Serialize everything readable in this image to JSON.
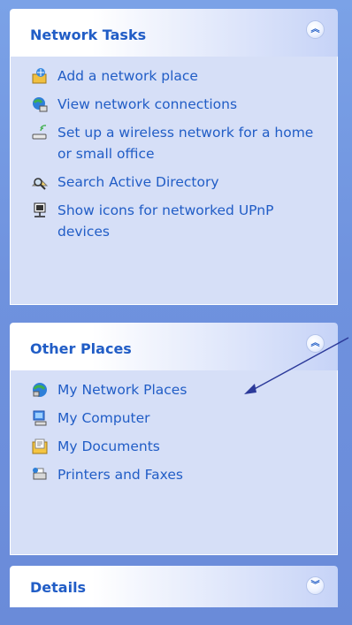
{
  "network_tasks": {
    "title": "Network Tasks",
    "items": [
      {
        "icon": "add-network-place-icon",
        "label": "Add a network place"
      },
      {
        "icon": "view-network-connections-icon",
        "label": "View network connections"
      },
      {
        "icon": "wireless-network-icon",
        "label": "Set up a wireless network for a home or small office"
      },
      {
        "icon": "search-directory-icon",
        "label": "Search Active Directory"
      },
      {
        "icon": "upnp-devices-icon",
        "label": "Show icons for networked UPnP devices"
      }
    ]
  },
  "other_places": {
    "title": "Other Places",
    "items": [
      {
        "icon": "my-network-places-icon",
        "label": "My Network Places"
      },
      {
        "icon": "my-computer-icon",
        "label": "My Computer"
      },
      {
        "icon": "my-documents-icon",
        "label": "My Documents"
      },
      {
        "icon": "printers-faxes-icon",
        "label": "Printers and Faxes"
      }
    ]
  },
  "details": {
    "title": "Details"
  },
  "colors": {
    "link": "#215dc6",
    "panel_body": "#d6dff7",
    "background": "#6f92de",
    "annotation_arrow": "#2c3a9a"
  }
}
